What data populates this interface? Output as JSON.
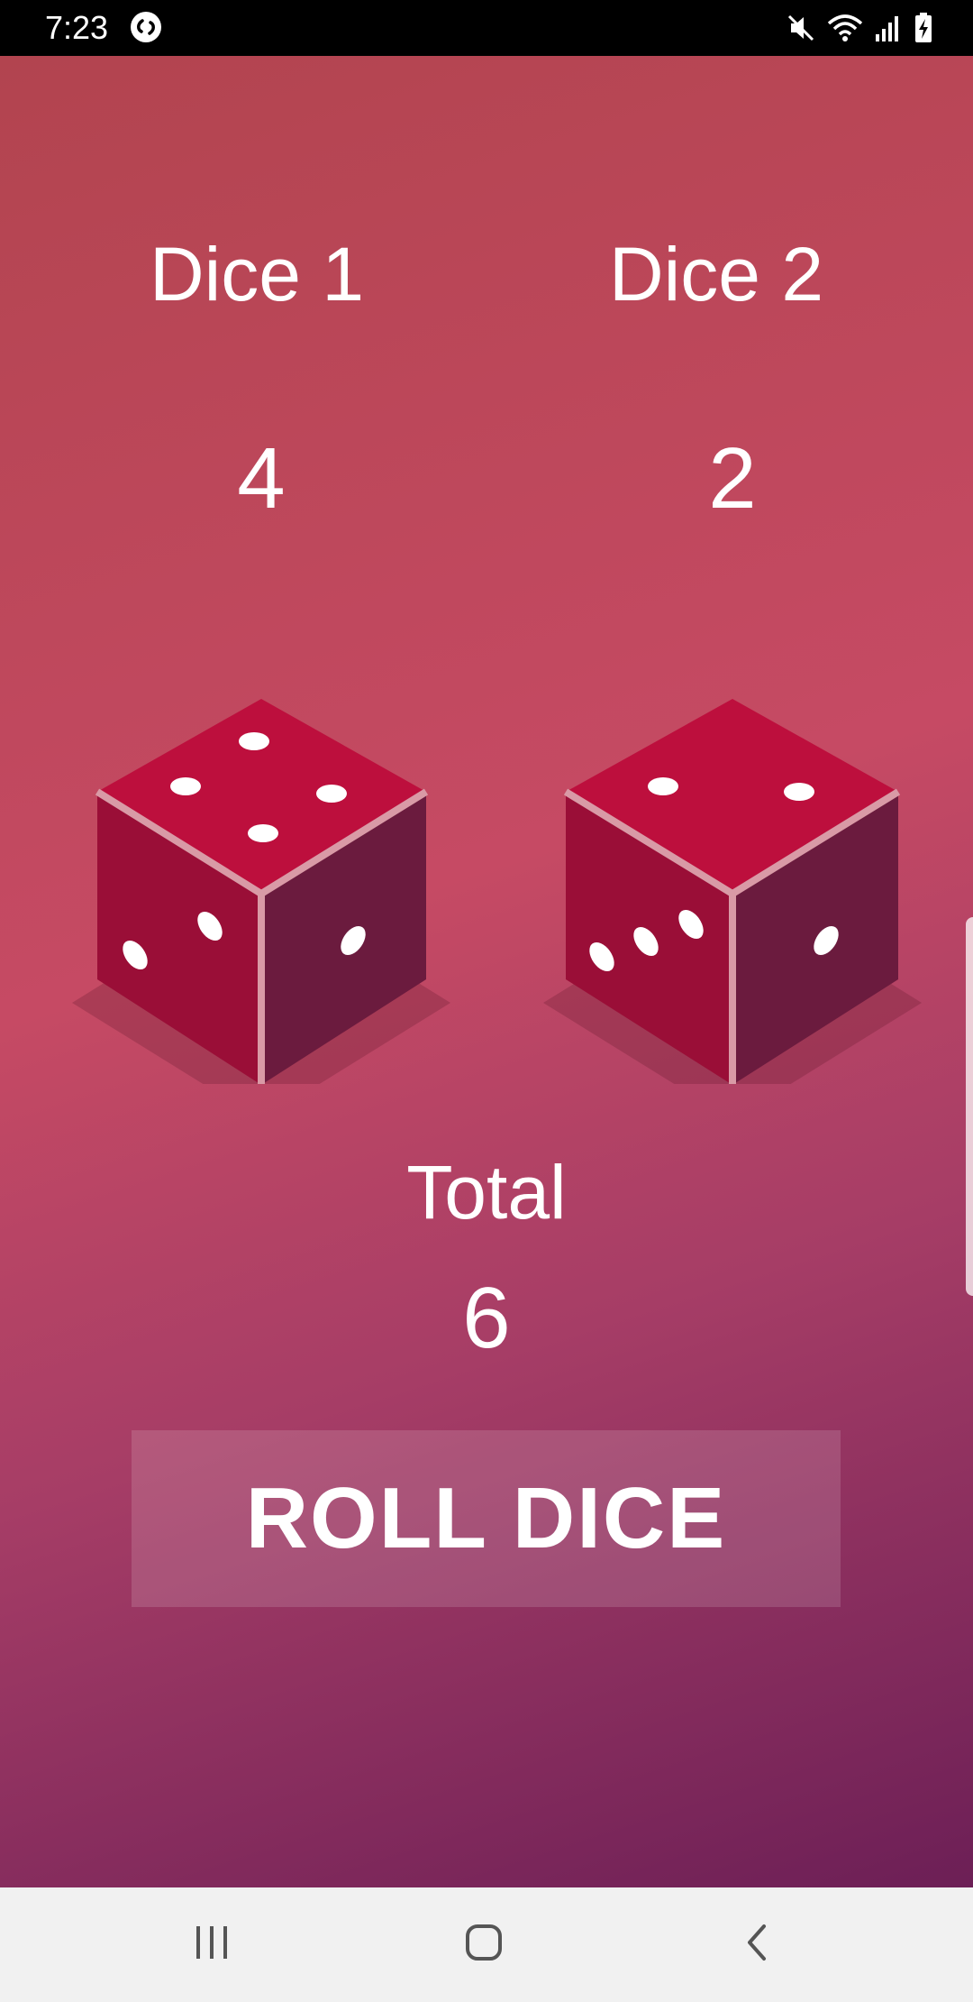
{
  "status_bar": {
    "time": "7:23",
    "icons": [
      "shazam-icon",
      "mute-icon",
      "wifi-icon",
      "signal-icon",
      "battery-charging-icon"
    ]
  },
  "dice": [
    {
      "label": "Dice 1",
      "value": "4"
    },
    {
      "label": "Dice 2",
      "value": "2"
    }
  ],
  "total": {
    "label": "Total",
    "value": "6"
  },
  "roll_button": {
    "label": "ROLL DICE"
  },
  "nav_bar": {
    "icons": [
      "recent-apps-icon",
      "home-icon",
      "back-icon"
    ]
  },
  "colors": {
    "die_top": "#bd0f3d",
    "die_left": "#9a0e37",
    "die_right": "#6b1b3e",
    "die_edge": "#d99aa6",
    "pip": "#ffffff"
  }
}
